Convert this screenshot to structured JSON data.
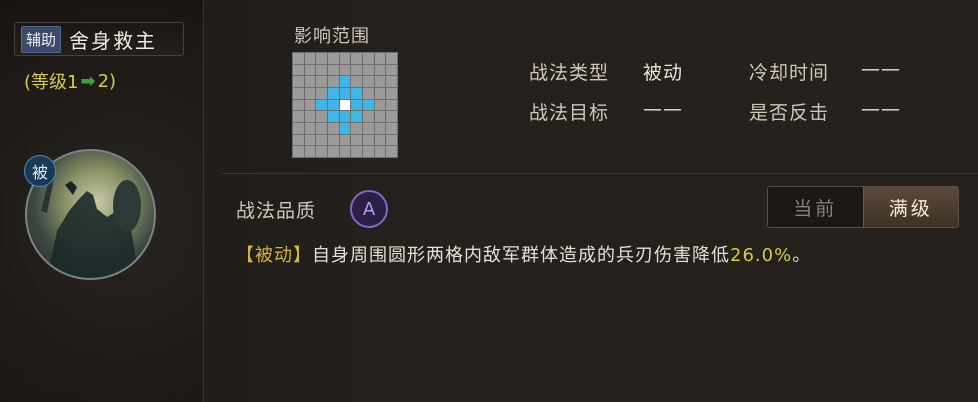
{
  "header": {
    "role_tag": "辅助",
    "skill_name": "舍身救主",
    "level_prefix": "(等级1",
    "level_arrow": "➡",
    "level_suffix": "2)",
    "passive_badge": "被"
  },
  "range": {
    "label": "影响范围",
    "grid_size": 9,
    "center": [
      4,
      4
    ],
    "highlighted": [
      [
        3,
        4
      ],
      [
        5,
        4
      ],
      [
        4,
        3
      ],
      [
        4,
        5
      ],
      [
        2,
        4
      ],
      [
        6,
        4
      ],
      [
        4,
        2
      ],
      [
        4,
        6
      ],
      [
        3,
        3
      ],
      [
        3,
        5
      ],
      [
        5,
        3
      ],
      [
        5,
        5
      ]
    ]
  },
  "info": {
    "type_label": "战法类型",
    "type_value": "被动",
    "target_label": "战法目标",
    "target_value": "——",
    "cooldown_label": "冷却时间",
    "cooldown_value": "——",
    "counter_label": "是否反击",
    "counter_value": "——"
  },
  "quality": {
    "label": "战法品质",
    "grade": "A"
  },
  "toggle": {
    "current_label": "当前",
    "max_label": "满级",
    "selected": "max"
  },
  "description": {
    "tag": "【被动】",
    "text": "自身周围圆形两格内敌军群体造成的兵刃伤害降低",
    "value": "26.0%",
    "end": "。"
  },
  "colors": {
    "grid_highlight": "#3eb6e8",
    "level_text": "#d9c94c",
    "arrow": "#38a832",
    "quality_purple": "#8a62c9"
  }
}
